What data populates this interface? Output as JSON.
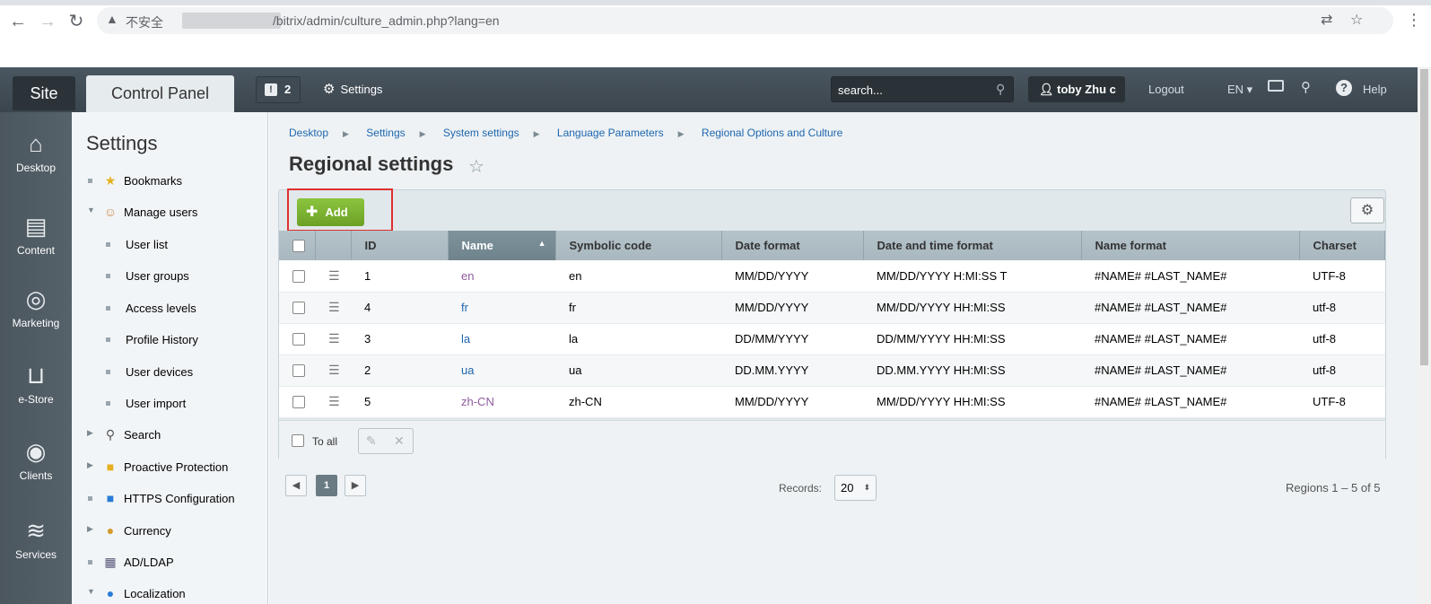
{
  "browser": {
    "insecure_label": "不安全",
    "url": "/bitrix/admin/culture_admin.php?lang=en"
  },
  "topbar": {
    "site_tab": "Site",
    "control_panel_tab": "Control Panel",
    "notification_count": "2",
    "settings_label": "Settings",
    "search_placeholder": "search...",
    "user_name": "toby Zhu c",
    "logout_label": "Logout",
    "language": "EN",
    "help_label": "Help"
  },
  "iconbar": {
    "items": [
      {
        "label": "Desktop",
        "icon": "home-icon"
      },
      {
        "label": "Content",
        "icon": "document-icon"
      },
      {
        "label": "Marketing",
        "icon": "target-icon"
      },
      {
        "label": "e-Store",
        "icon": "basket-icon"
      },
      {
        "label": "Clients",
        "icon": "clients-24-icon"
      },
      {
        "label": "Services",
        "icon": "layers-icon"
      }
    ]
  },
  "sidebar": {
    "title": "Settings",
    "items": [
      {
        "label": "Bookmarks"
      },
      {
        "label": "Manage users"
      },
      {
        "label": "User list"
      },
      {
        "label": "User groups"
      },
      {
        "label": "Access levels"
      },
      {
        "label": "Profile History"
      },
      {
        "label": "User devices"
      },
      {
        "label": "User import"
      },
      {
        "label": "Search"
      },
      {
        "label": "Proactive Protection"
      },
      {
        "label": "HTTPS Configuration"
      },
      {
        "label": "Currency"
      },
      {
        "label": "AD/LDAP"
      },
      {
        "label": "Localization"
      }
    ]
  },
  "breadcrumb": [
    "Desktop",
    "Settings",
    "System settings",
    "Language Parameters",
    "Regional Options and Culture"
  ],
  "page_title": "Regional settings",
  "toolbar": {
    "add_label": "Add"
  },
  "table": {
    "columns": [
      "ID",
      "Name",
      "Symbolic code",
      "Date format",
      "Date and time format",
      "Name format",
      "Charset"
    ],
    "rows": [
      {
        "id": "1",
        "name": "en",
        "code": "en",
        "date": "MM/DD/YYYY",
        "datetime": "MM/DD/YYYY H:MI:SS T",
        "name_format": "#NAME# #LAST_NAME#",
        "charset": "UTF-8"
      },
      {
        "id": "4",
        "name": "fr",
        "code": "fr",
        "date": "MM/DD/YYYY",
        "datetime": "MM/DD/YYYY HH:MI:SS",
        "name_format": "#NAME# #LAST_NAME#",
        "charset": "utf-8"
      },
      {
        "id": "3",
        "name": "la",
        "code": "la",
        "date": "DD/MM/YYYY",
        "datetime": "DD/MM/YYYY HH:MI:SS",
        "name_format": "#NAME# #LAST_NAME#",
        "charset": "utf-8"
      },
      {
        "id": "2",
        "name": "ua",
        "code": "ua",
        "date": "DD.MM.YYYY",
        "datetime": "DD.MM.YYYY HH:MI:SS",
        "name_format": "#NAME# #LAST_NAME#",
        "charset": "utf-8"
      },
      {
        "id": "5",
        "name": "zh-CN",
        "code": "zh-CN",
        "date": "MM/DD/YYYY",
        "datetime": "MM/DD/YYYY HH:MI:SS",
        "name_format": "#NAME# #LAST_NAME#",
        "charset": "UTF-8"
      }
    ],
    "to_all_label": "To all"
  },
  "pagination": {
    "current_page": "1",
    "records_label": "Records:",
    "records_value": "20",
    "summary": "Regions 1 – 5 of 5"
  }
}
